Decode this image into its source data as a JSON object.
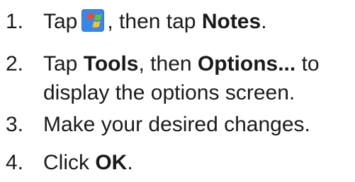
{
  "steps": [
    {
      "number": "1.",
      "pre": "Tap",
      "icon": "windows-start-icon",
      "mid": ", then tap",
      "bold": "Notes",
      "post": "."
    },
    {
      "number": "2.",
      "pre": "Tap",
      "bold1": "Tools",
      "mid": ", then",
      "bold2": "Options...",
      "post": "to",
      "line2": "display the options screen."
    },
    {
      "number": "3.",
      "text": "Make your desired changes."
    },
    {
      "number": "4.",
      "pre": "Click",
      "bold": "OK",
      "post": "."
    }
  ]
}
